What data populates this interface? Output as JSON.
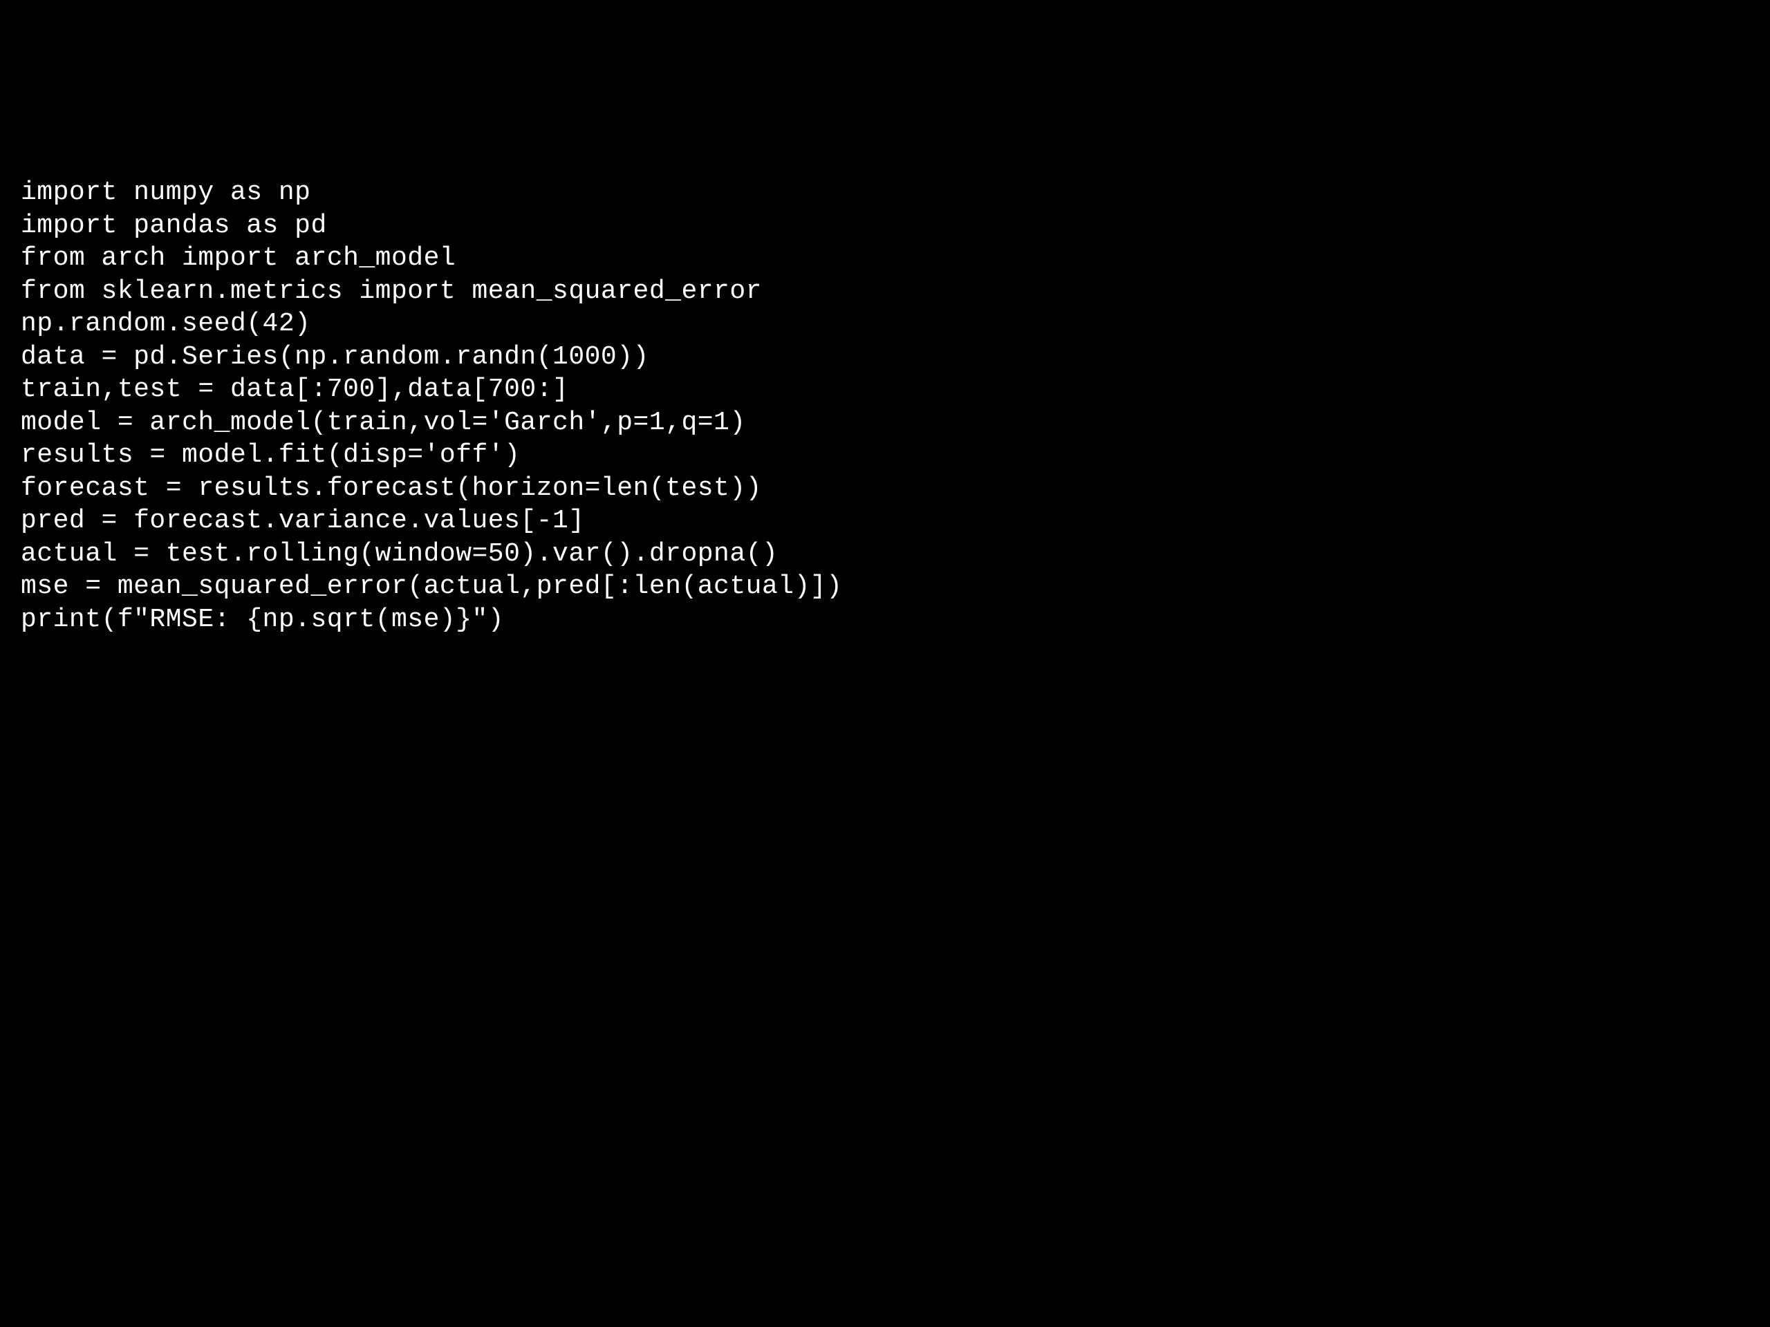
{
  "code": {
    "lines": [
      "import numpy as np",
      "import pandas as pd",
      "from arch import arch_model",
      "from sklearn.metrics import mean_squared_error",
      "",
      "np.random.seed(42)",
      "data = pd.Series(np.random.randn(1000))",
      "train,test = data[:700],data[700:]",
      "",
      "model = arch_model(train,vol='Garch',p=1,q=1)",
      "results = model.fit(disp='off')",
      "",
      "forecast = results.forecast(horizon=len(test))",
      "pred = forecast.variance.values[-1]",
      "",
      "actual = test.rolling(window=50).var().dropna()",
      "mse = mean_squared_error(actual,pred[:len(actual)])",
      "print(f\"RMSE: {np.sqrt(mse)}\")"
    ]
  }
}
